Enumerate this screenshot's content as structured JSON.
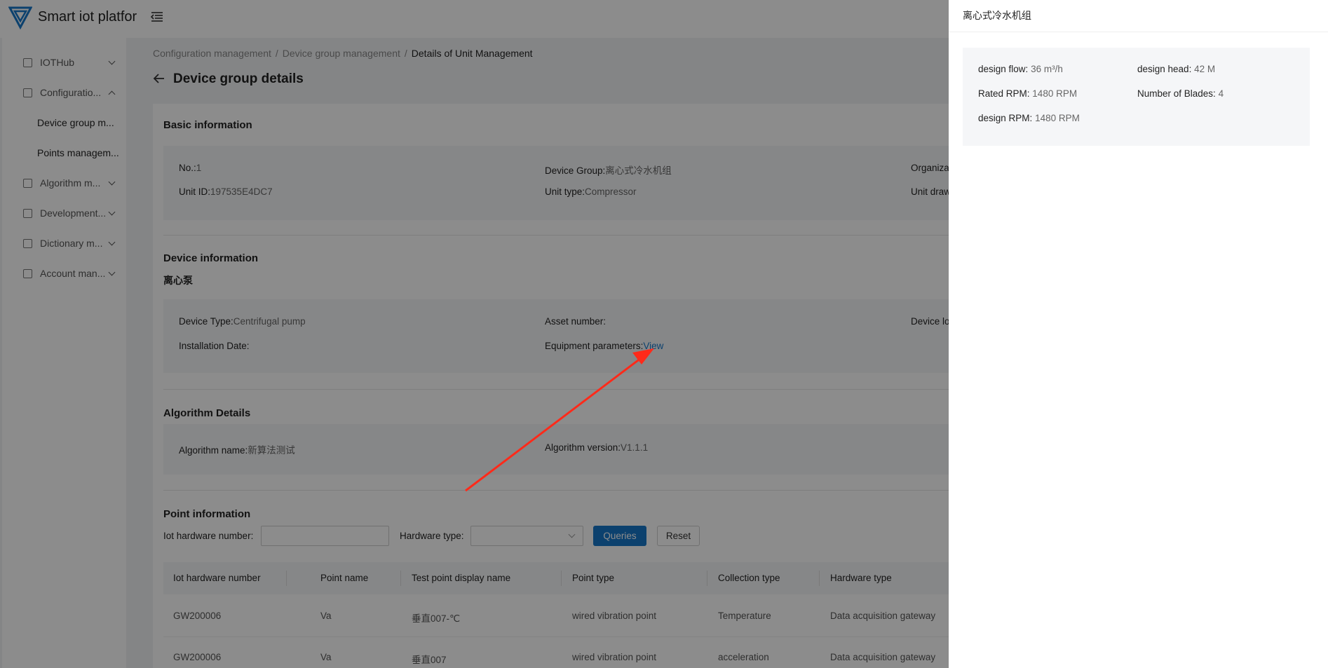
{
  "app": {
    "brand": "Smart iot platfor"
  },
  "sidebar": {
    "items": [
      {
        "label": "IOTHub",
        "expanded": false
      },
      {
        "label": "Configuratio...",
        "expanded": true
      },
      {
        "label": "Algorithm m...",
        "expanded": false
      },
      {
        "label": "Development...",
        "expanded": false
      },
      {
        "label": "Dictionary m...",
        "expanded": false
      },
      {
        "label": "Account man...",
        "expanded": false
      }
    ],
    "sub_items": [
      {
        "label": "Device group m..."
      },
      {
        "label": "Points managem..."
      }
    ]
  },
  "breadcrumb": {
    "items": [
      "Configuration management",
      "Device group management",
      "Details of Unit Management"
    ],
    "separator": "/"
  },
  "page": {
    "title": "Device group details"
  },
  "basic_info": {
    "title": "Basic information",
    "no_label": "No.:",
    "no_value": "1",
    "device_group_label": "Device Group:",
    "device_group_value": "离心式冷水机组",
    "organization_label": "Organiza",
    "unit_id_label": "Unit ID:",
    "unit_id_value": "197535E4DC7",
    "unit_type_label": "Unit type:",
    "unit_type_value": "Compressor",
    "unit_drawing_label": "Unit draw"
  },
  "device_info": {
    "title": "Device information",
    "subtitle": "离心泵",
    "device_type_label": "Device Type:",
    "device_type_value": "Centrifugal pump",
    "asset_number_label": "Asset number:",
    "device_location_label": "Device lo",
    "installation_date_label": "Installation Date:",
    "equipment_params_label": "Equipment parameters:",
    "view_link": "View"
  },
  "algorithm": {
    "title": "Algorithm Details",
    "name_label": "Algorithm name:",
    "name_value": "新算法测试",
    "version_label": "Algorithm version:",
    "version_value": "V1.1.1"
  },
  "points": {
    "title": "Point information",
    "iot_number_label": "Iot hardware number:",
    "iot_number_value": "",
    "hardware_type_label": "Hardware type:",
    "hardware_type_value": "",
    "query_button": "Queries",
    "reset_button": "Reset",
    "columns": [
      "Iot hardware number",
      "Point name",
      "Test point display name",
      "Point type",
      "Collection type",
      "Hardware type"
    ],
    "rows": [
      [
        "GW200006",
        "Va",
        "垂直007-℃",
        "wired vibration point",
        "Temperature",
        "Data acquisition gateway"
      ],
      [
        "GW200006",
        "Va",
        "垂直007",
        "wired vibration point",
        "acceleration",
        "Data acquisition gateway"
      ]
    ]
  },
  "drawer": {
    "title": "离心式冷水机组",
    "params": [
      {
        "label": "design flow:",
        "value": "36 m³/h"
      },
      {
        "label": "design head:",
        "value": "42 M"
      },
      {
        "label": "Rated RPM:",
        "value": "1480 RPM"
      },
      {
        "label": "Number of Blades:",
        "value": "4"
      },
      {
        "label": "design RPM:",
        "value": "1480 RPM"
      }
    ]
  },
  "colors": {
    "primary": "#1677c9",
    "arrow": "#ff2a1a",
    "overlay": "rgba(0,0,0,0.45)"
  }
}
